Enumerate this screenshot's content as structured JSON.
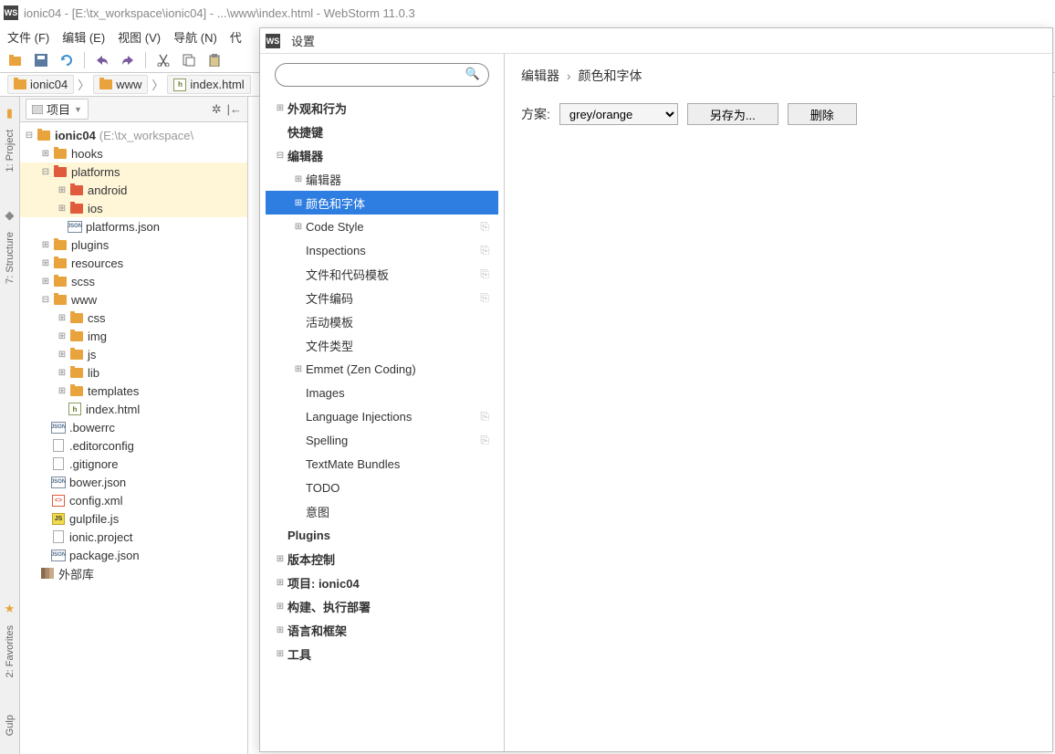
{
  "window": {
    "title": "ionic04 - [E:\\tx_workspace\\ionic04] - ...\\www\\index.html - WebStorm 11.0.3"
  },
  "menu": [
    "文件 (F)",
    "编辑 (E)",
    "视图 (V)",
    "导航 (N)",
    "代"
  ],
  "breadcrumb": {
    "proj": "ionic04",
    "www": "www",
    "file": "index.html"
  },
  "projectPanel": {
    "header": "项目"
  },
  "tree": {
    "root": "ionic04",
    "rootHint": "(E:\\tx_workspace\\",
    "hooks": "hooks",
    "platforms": "platforms",
    "android": "android",
    "ios": "ios",
    "platformsJson": "platforms.json",
    "plugins": "plugins",
    "resources": "resources",
    "scss": "scss",
    "www": "www",
    "css": "css",
    "img": "img",
    "js": "js",
    "lib": "lib",
    "templates": "templates",
    "indexHtml": "index.html",
    "bowerrc": ".bowerrc",
    "editorconfig": ".editorconfig",
    "gitignore": ".gitignore",
    "bowerJson": "bower.json",
    "configXml": "config.xml",
    "gulpfile": "gulpfile.js",
    "ionicProject": "ionic.project",
    "packageJson": "package.json",
    "extLibs": "外部库"
  },
  "leftStrip": {
    "project": "1: Project",
    "structure": "7: Structure",
    "favorites": "2: Favorites",
    "gulp": "Gulp"
  },
  "dialog": {
    "title": "设置",
    "searchPlaceholder": "",
    "path": {
      "a": "编辑器",
      "b": "颜色和字体"
    },
    "schemeLabel": "方案:",
    "schemeValue": "grey/orange",
    "saveAs": "另存为...",
    "delete": "删除",
    "nav": {
      "appearance": "外观和行为",
      "keymap": "快捷键",
      "editor": "编辑器",
      "editor2": "编辑器",
      "colors": "颜色和字体",
      "codeStyle": "Code Style",
      "inspections": "Inspections",
      "fileTemplates": "文件和代码模板",
      "encoding": "文件编码",
      "liveTemplates": "活动模板",
      "fileTypes": "文件类型",
      "emmet": "Emmet (Zen Coding)",
      "images": "Images",
      "langInjections": "Language Injections",
      "spelling": "Spelling",
      "textmate": "TextMate Bundles",
      "todo": "TODO",
      "intentions": "意图",
      "plugins": "Plugins",
      "vcs": "版本控制",
      "project": "项目: ionic04",
      "build": "构建、执行部署",
      "langs": "语言和框架",
      "tools": "工具"
    }
  }
}
